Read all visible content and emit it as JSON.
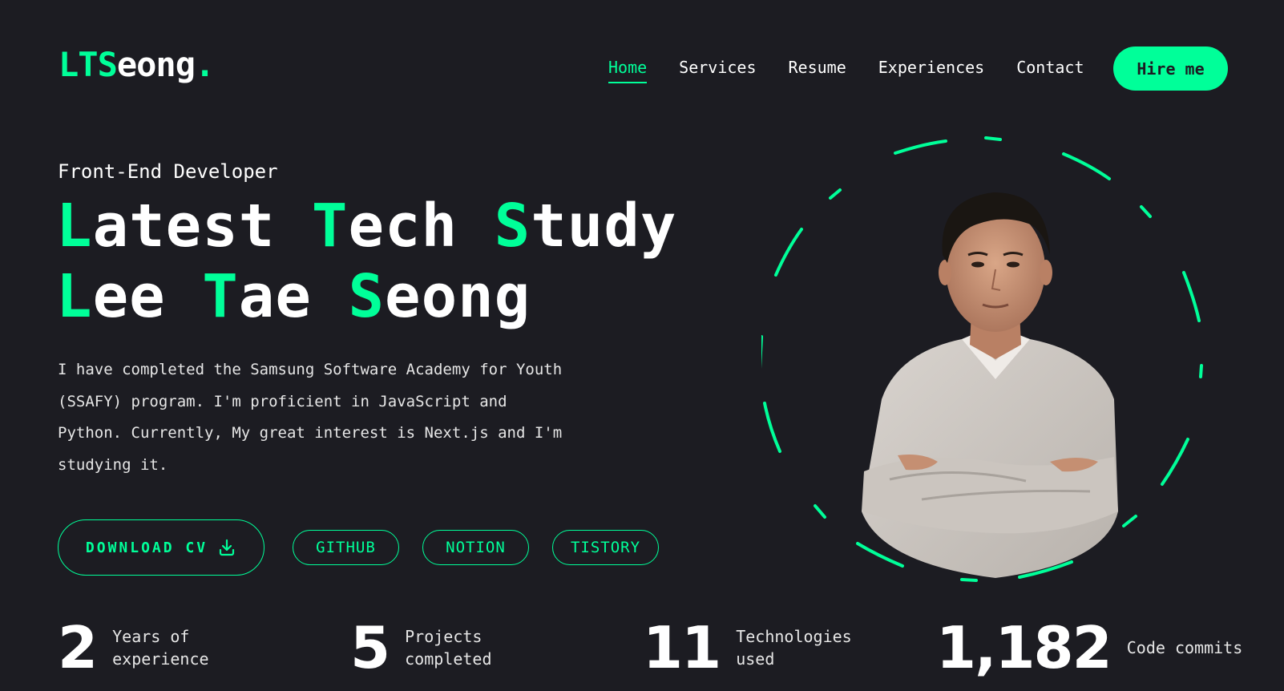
{
  "header": {
    "logo_part1": "LTS",
    "logo_part2": "eong",
    "logo_dot": ".",
    "nav": [
      "Home",
      "Services",
      "Resume",
      "Experiences",
      "Contact"
    ],
    "active_nav": "Home",
    "hire_label": "Hire me"
  },
  "hero": {
    "role": "Front-End Developer",
    "headline": {
      "line1": [
        {
          "first": "L",
          "rest": "atest"
        },
        {
          "first": "T",
          "rest": "ech"
        },
        {
          "first": "S",
          "rest": "tudy"
        }
      ],
      "line2": [
        {
          "first": "L",
          "rest": "ee"
        },
        {
          "first": "T",
          "rest": "ae"
        },
        {
          "first": "S",
          "rest": "eong"
        }
      ]
    },
    "intro": "I have completed the Samsung Software Academy for Youth (SSAFY) program. I'm proficient in JavaScript and Python. Currently, My great interest is Next.js and I'm studying it.",
    "download_label": "DOWNLOAD CV",
    "links": [
      "GITHUB",
      "NOTION",
      "TISTORY"
    ]
  },
  "stats": [
    {
      "value": "2",
      "label": "Years of experience"
    },
    {
      "value": "5",
      "label": "Projects completed"
    },
    {
      "value": "11",
      "label": "Technologies used"
    },
    {
      "value": "1,182",
      "label": "Code commits"
    }
  ],
  "colors": {
    "accent": "#00ff99",
    "background": "#1c1c22",
    "text": "#ffffff"
  },
  "icons": {
    "download": "download-icon"
  }
}
